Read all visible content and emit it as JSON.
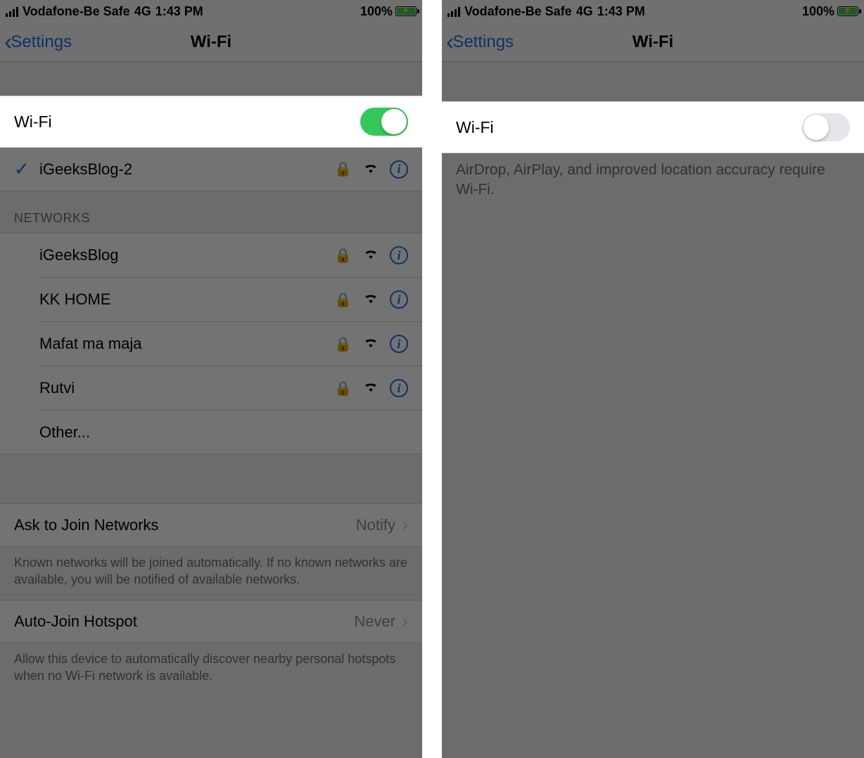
{
  "statusbar": {
    "carrier": "Vodafone-Be Safe",
    "network": "4G",
    "time": "1:43 PM",
    "battery_pct": "100%"
  },
  "nav": {
    "back_label": "Settings",
    "title": "Wi-Fi"
  },
  "left": {
    "wifi_label": "Wi-Fi",
    "connected_network": "iGeeksBlog-2",
    "networks_header": "NETWORKS",
    "networks": [
      {
        "name": "iGeeksBlog",
        "secure": true
      },
      {
        "name": "KK HOME",
        "secure": true
      },
      {
        "name": "Mafat ma maja",
        "secure": true
      },
      {
        "name": "Rutvi",
        "secure": true
      }
    ],
    "other_label": "Other...",
    "ask_label": "Ask to Join Networks",
    "ask_value": "Notify",
    "ask_footer": "Known networks will be joined automatically. If no known networks are available, you will be notified of available networks.",
    "auto_label": "Auto-Join Hotspot",
    "auto_value": "Never",
    "auto_footer": "Allow this device to automatically discover nearby personal hotspots when no Wi-Fi network is available."
  },
  "right": {
    "wifi_label": "Wi-Fi",
    "footer": "AirDrop, AirPlay, and improved location accuracy require Wi-Fi."
  }
}
